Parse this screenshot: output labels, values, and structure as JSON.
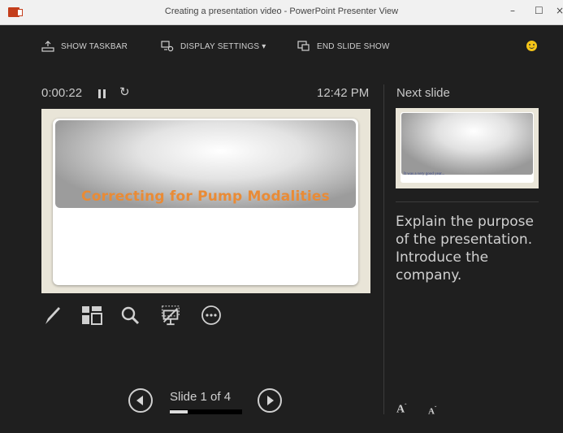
{
  "window": {
    "title": "Creating a presentation video - PowerPoint Presenter View",
    "minimize": "–",
    "maximize": "☐",
    "close": "×"
  },
  "toolbar": {
    "show_taskbar": "SHOW TASKBAR",
    "display_settings": "DISPLAY SETTINGS ▾",
    "end_slide_show": "END SLIDE SHOW"
  },
  "status": {
    "timer": "0:00:22",
    "reset": "↻",
    "clock": "12:42 PM"
  },
  "current_slide": {
    "title": "Correcting for Pump Modalities"
  },
  "next_slide": {
    "label": "Next slide",
    "caption": "It was a very good year..."
  },
  "notes": {
    "text": "Explain the purpose of the presentation. Introduce the company."
  },
  "font_controls": {
    "increase": "A",
    "decrease": "A"
  },
  "navigation": {
    "counter": "Slide 1 of 4",
    "progress_fraction": 0.25
  },
  "colors": {
    "background": "#1f1f1f",
    "slide_title": "#e98b36",
    "next_caption": "#3b4a8b",
    "smiley": "#f5c518"
  },
  "tools": [
    "pen-icon",
    "see-all-slides-icon",
    "zoom-icon",
    "black-screen-icon",
    "more-options-icon"
  ]
}
